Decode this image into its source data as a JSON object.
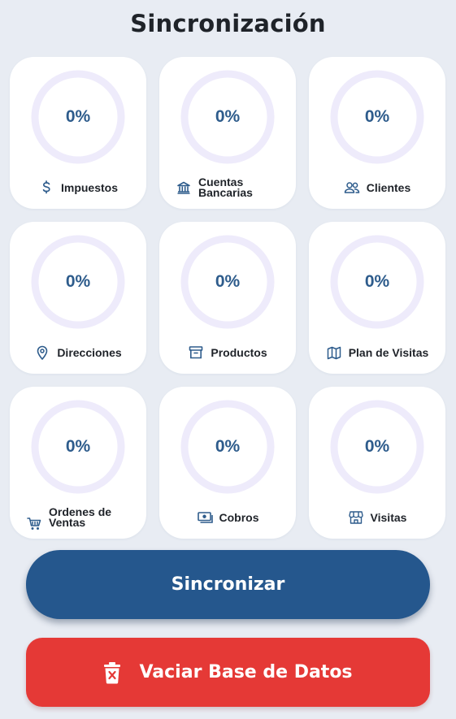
{
  "header": {
    "title": "Sincronización"
  },
  "modules": [
    {
      "percent": "0%",
      "label": "Impuestos",
      "icon": "dollar-icon"
    },
    {
      "percent": "0%",
      "label": "Cuentas Bancarias",
      "icon": "bank-icon"
    },
    {
      "percent": "0%",
      "label": "Clientes",
      "icon": "users-icon"
    },
    {
      "percent": "0%",
      "label": "Direcciones",
      "icon": "map-pin-icon"
    },
    {
      "percent": "0%",
      "label": "Productos",
      "icon": "archive-box-icon"
    },
    {
      "percent": "0%",
      "label": "Plan de Visitas",
      "icon": "map-icon"
    },
    {
      "percent": "0%",
      "label": "Ordenes de Ventas",
      "icon": "cart-icon"
    },
    {
      "percent": "0%",
      "label": "Cobros",
      "icon": "money-icon"
    },
    {
      "percent": "0%",
      "label": "Visitas",
      "icon": "store-icon"
    }
  ],
  "actions": {
    "sync_label": "Sincronizar",
    "clear_label": "Vaciar Base de Datos"
  },
  "colors": {
    "primary": "#25578d",
    "danger": "#e53936",
    "ring_track": "#eeebfb",
    "percent_text": "#2e5c8c",
    "background": "#e8ecf3"
  }
}
